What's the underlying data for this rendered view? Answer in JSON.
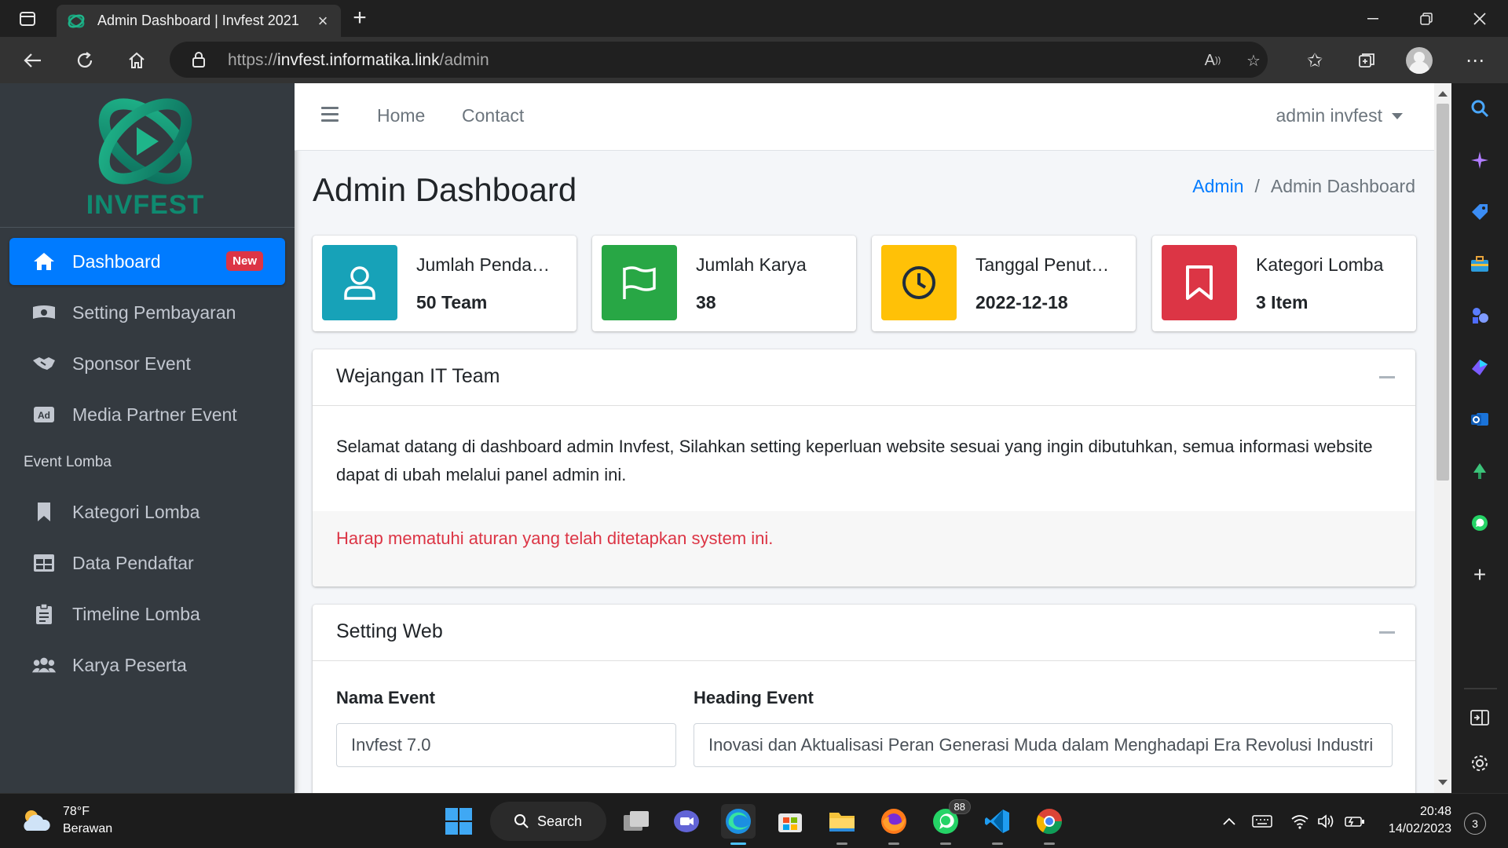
{
  "browser": {
    "tab_title": "Admin Dashboard | Invfest 2021",
    "url_scheme": "https://",
    "url_host": "invfest.informatika.link",
    "url_path": "/admin"
  },
  "sidebar": {
    "brand": "INVFEST",
    "items": [
      {
        "label": "Dashboard",
        "icon": "home-icon",
        "badge": "New",
        "active": true
      },
      {
        "label": "Setting Pembayaran",
        "icon": "money-icon"
      },
      {
        "label": "Sponsor Event",
        "icon": "handshake-icon"
      },
      {
        "label": "Media Partner Event",
        "icon": "ad-icon"
      },
      {
        "label": "Kategori Lomba",
        "icon": "bookmark-icon"
      },
      {
        "label": "Data Pendaftar",
        "icon": "table-icon"
      },
      {
        "label": "Timeline Lomba",
        "icon": "clipboard-icon"
      },
      {
        "label": "Karya Peserta",
        "icon": "users-icon"
      }
    ],
    "section_header": "Event Lomba"
  },
  "navbar": {
    "home": "Home",
    "contact": "Contact",
    "user": "admin invfest"
  },
  "page": {
    "title": "Admin Dashboard",
    "breadcrumb": [
      "Admin",
      "Admin Dashboard"
    ]
  },
  "info_boxes": [
    {
      "label": "Jumlah Pendaftar",
      "display_label": "Jumlah Penda…",
      "value": "50 Team",
      "color": "#17a2b8",
      "icon": "user-icon"
    },
    {
      "label": "Jumlah Karya",
      "display_label": "Jumlah Karya",
      "value": "38",
      "color": "#28a745",
      "icon": "flag-icon"
    },
    {
      "label": "Tanggal Penutupan",
      "display_label": "Tanggal Penut…",
      "value": "2022-12-18",
      "color": "#ffc107",
      "icon": "clock-icon"
    },
    {
      "label": "Kategori Lomba",
      "display_label": "Kategori Lomba",
      "value": "3 Item",
      "color": "#dc3545",
      "icon": "bookmark-icon"
    }
  ],
  "wejangan": {
    "title": "Wejangan IT Team",
    "body": "Selamat datang di dashboard admin Invfest, Silahkan setting keperluan website sesuai yang ingin dibutuhkan, semua informasi website dapat di ubah melalui panel admin ini.",
    "warning": "Harap mematuhi aturan yang telah ditetapkan system ini."
  },
  "setting_web": {
    "title": "Setting Web",
    "nama_event_label": "Nama Event",
    "nama_event_value": "Invfest 7.0",
    "heading_event_label": "Heading Event",
    "heading_event_value": "Inovasi dan Aktualisasi Peran Generasi Muda dalam Menghadapi Era Revolusi Industri"
  },
  "taskbar": {
    "weather_temp": "78°F",
    "weather_desc": "Berawan",
    "search_label": "Search",
    "whatsapp_badge": "88",
    "time": "20:48",
    "date": "14/02/2023",
    "notifications": "3"
  },
  "colors": {
    "primary": "#007bff",
    "sidebar_bg": "#343a40",
    "danger": "#dc3545"
  }
}
